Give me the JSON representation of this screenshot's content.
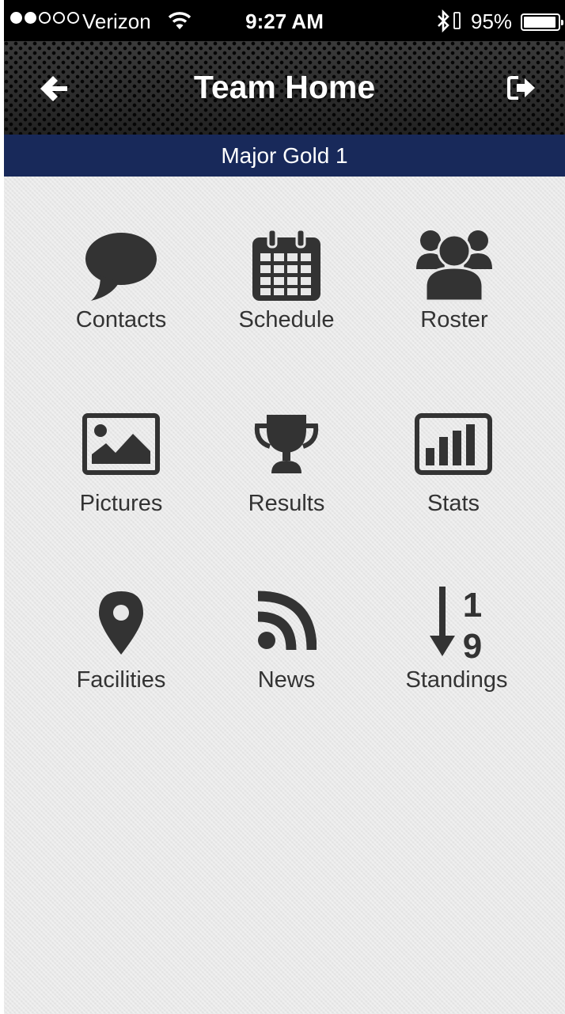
{
  "status_bar": {
    "carrier": "Verizon",
    "time": "9:27 AM",
    "battery": "95%",
    "battery_level": 0.95,
    "signal_bars": 2,
    "signal_total": 5
  },
  "nav": {
    "title": "Team Home",
    "back_icon": "back-arrow-icon",
    "logout_icon": "sign-out-icon"
  },
  "team": {
    "name": "Major Gold 1"
  },
  "menu": [
    {
      "label": "Contacts",
      "icon": "speech-bubble-icon"
    },
    {
      "label": "Schedule",
      "icon": "calendar-icon"
    },
    {
      "label": "Roster",
      "icon": "group-icon"
    },
    {
      "label": "Pictures",
      "icon": "picture-icon"
    },
    {
      "label": "Results",
      "icon": "trophy-icon"
    },
    {
      "label": "Stats",
      "icon": "bar-chart-icon"
    },
    {
      "label": "Facilities",
      "icon": "map-marker-icon"
    },
    {
      "label": "News",
      "icon": "rss-icon"
    },
    {
      "label": "Standings",
      "icon": "sort-numeric-icon",
      "glyph_top": "1",
      "glyph_bottom": "9"
    }
  ],
  "colors": {
    "status_bar_bg": "#000000",
    "team_band_bg": "#18295a",
    "icon_color": "#333333",
    "background": "#e8e8e8"
  }
}
